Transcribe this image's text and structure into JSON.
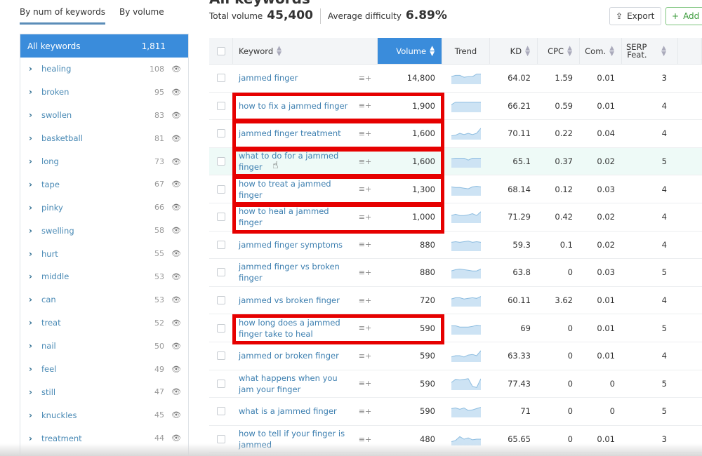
{
  "header": {
    "title": "All keywords",
    "total_volume_label": "Total volume",
    "total_volume": "45,400",
    "avg_difficulty_label": "Average difficulty",
    "avg_difficulty": "6.89%",
    "export_label": "Export",
    "add_label": "Add t"
  },
  "sidebar": {
    "tabs": [
      {
        "label": "By num of keywords",
        "active": true
      },
      {
        "label": "By volume",
        "active": false
      }
    ],
    "all_keywords": {
      "label": "All keywords",
      "count": "1,811"
    },
    "groups": [
      {
        "name": "healing",
        "count": "108"
      },
      {
        "name": "broken",
        "count": "95"
      },
      {
        "name": "swollen",
        "count": "83"
      },
      {
        "name": "basketball",
        "count": "81"
      },
      {
        "name": "long",
        "count": "73"
      },
      {
        "name": "tape",
        "count": "67"
      },
      {
        "name": "pinky",
        "count": "66"
      },
      {
        "name": "swelling",
        "count": "58"
      },
      {
        "name": "hurt",
        "count": "55"
      },
      {
        "name": "middle",
        "count": "53"
      },
      {
        "name": "can",
        "count": "53"
      },
      {
        "name": "treat",
        "count": "52"
      },
      {
        "name": "nail",
        "count": "50"
      },
      {
        "name": "feel",
        "count": "49"
      },
      {
        "name": "still",
        "count": "47"
      },
      {
        "name": "knuckles",
        "count": "45"
      },
      {
        "name": "treatment",
        "count": "44"
      }
    ]
  },
  "table": {
    "columns": {
      "keyword": "Keyword",
      "volume": "Volume",
      "trend": "Trend",
      "kd": "KD",
      "cpc": "CPC",
      "com": "Com.",
      "serp_line1": "SERP",
      "serp_line2": "Feat."
    },
    "rows": [
      {
        "keyword": "jammed finger",
        "volume": "14,800",
        "kd": "64.02",
        "cpc": "1.59",
        "com": "0.01",
        "serp": "3",
        "highlighted": false,
        "trend": [
          0.6,
          0.7,
          0.7,
          0.55,
          0.6,
          0.6,
          0.8,
          0.8
        ]
      },
      {
        "keyword": "how to fix a jammed finger",
        "volume": "1,900",
        "kd": "66.21",
        "cpc": "0.59",
        "com": "0.01",
        "serp": "4",
        "highlighted": true,
        "trend": [
          0.6,
          0.8,
          0.8,
          0.8,
          0.8,
          0.8,
          0.8,
          0.8
        ]
      },
      {
        "keyword": "jammed finger treatment",
        "volume": "1,600",
        "kd": "70.11",
        "cpc": "0.22",
        "com": "0.04",
        "serp": "4",
        "highlighted": true,
        "trend": [
          0.3,
          0.35,
          0.5,
          0.4,
          0.5,
          0.4,
          0.5,
          0.9
        ]
      },
      {
        "keyword": "what to do for a jammed finger",
        "volume": "1,600",
        "kd": "65.1",
        "cpc": "0.37",
        "com": "0.02",
        "serp": "5",
        "highlighted": true,
        "hover": true,
        "trend": [
          0.7,
          0.75,
          0.75,
          0.75,
          0.6,
          0.75,
          0.75,
          0.75
        ]
      },
      {
        "keyword": "how to treat a jammed finger",
        "volume": "1,300",
        "kd": "68.14",
        "cpc": "0.12",
        "com": "0.03",
        "serp": "4",
        "highlighted": true,
        "trend": [
          0.7,
          0.65,
          0.65,
          0.6,
          0.55,
          0.7,
          0.75,
          0.7
        ]
      },
      {
        "keyword": "how to heal a jammed finger",
        "volume": "1,000",
        "kd": "71.29",
        "cpc": "0.42",
        "com": "0.02",
        "serp": "4",
        "highlighted": true,
        "trend": [
          0.6,
          0.7,
          0.6,
          0.6,
          0.65,
          0.75,
          0.6,
          0.9
        ]
      },
      {
        "keyword": "jammed finger symptoms",
        "volume": "880",
        "kd": "59.3",
        "cpc": "0.1",
        "com": "0.02",
        "serp": "4",
        "highlighted": false,
        "trend": [
          0.7,
          0.75,
          0.7,
          0.75,
          0.8,
          0.7,
          0.75,
          0.7
        ]
      },
      {
        "keyword": "jammed finger vs broken finger",
        "volume": "880",
        "kd": "63.8",
        "cpc": "0",
        "com": "0.03",
        "serp": "5",
        "highlighted": false,
        "trend": [
          0.6,
          0.7,
          0.75,
          0.7,
          0.65,
          0.6,
          0.6,
          0.75
        ]
      },
      {
        "keyword": "jammed vs broken finger",
        "volume": "720",
        "kd": "60.11",
        "cpc": "3.62",
        "com": "0.01",
        "serp": "4",
        "highlighted": false,
        "trend": [
          0.6,
          0.7,
          0.7,
          0.6,
          0.65,
          0.7,
          0.65,
          0.8
        ]
      },
      {
        "keyword": "how long does a jammed finger take to heal",
        "volume": "590",
        "kd": "69",
        "cpc": "0",
        "com": "0.01",
        "serp": "5",
        "highlighted": true,
        "trend": [
          0.7,
          0.7,
          0.6,
          0.6,
          0.6,
          0.65,
          0.75,
          0.7
        ]
      },
      {
        "keyword": "jammed or broken finger",
        "volume": "590",
        "kd": "63.33",
        "cpc": "0",
        "com": "0.01",
        "serp": "4",
        "highlighted": false,
        "trend": [
          0.4,
          0.5,
          0.5,
          0.4,
          0.55,
          0.6,
          0.5,
          0.9
        ]
      },
      {
        "keyword": "what happens when you jam your finger",
        "volume": "590",
        "kd": "77.43",
        "cpc": "0",
        "com": "0",
        "serp": "5",
        "highlighted": false,
        "trend": [
          0.6,
          0.85,
          0.8,
          0.85,
          0.9,
          0.3,
          0.2,
          0.9
        ]
      },
      {
        "keyword": "what is a jammed finger",
        "volume": "590",
        "kd": "71",
        "cpc": "0",
        "com": "0",
        "serp": "5",
        "highlighted": false,
        "trend": [
          0.7,
          0.75,
          0.65,
          0.75,
          0.55,
          0.6,
          0.7,
          0.8
        ]
      },
      {
        "keyword": "how to tell if your finger is jammed",
        "volume": "480",
        "kd": "65.65",
        "cpc": "0",
        "com": "0.01",
        "serp": "3",
        "highlighted": false,
        "trend": [
          0.3,
          0.4,
          0.7,
          0.5,
          0.6,
          0.45,
          0.5,
          0.5
        ]
      }
    ]
  },
  "colors": {
    "accent": "#3a8cdb",
    "highlight_box": "#e60000",
    "link": "#3d7fb0",
    "trend_fill": "#cde3f4",
    "trend_line": "#8dbde0"
  }
}
